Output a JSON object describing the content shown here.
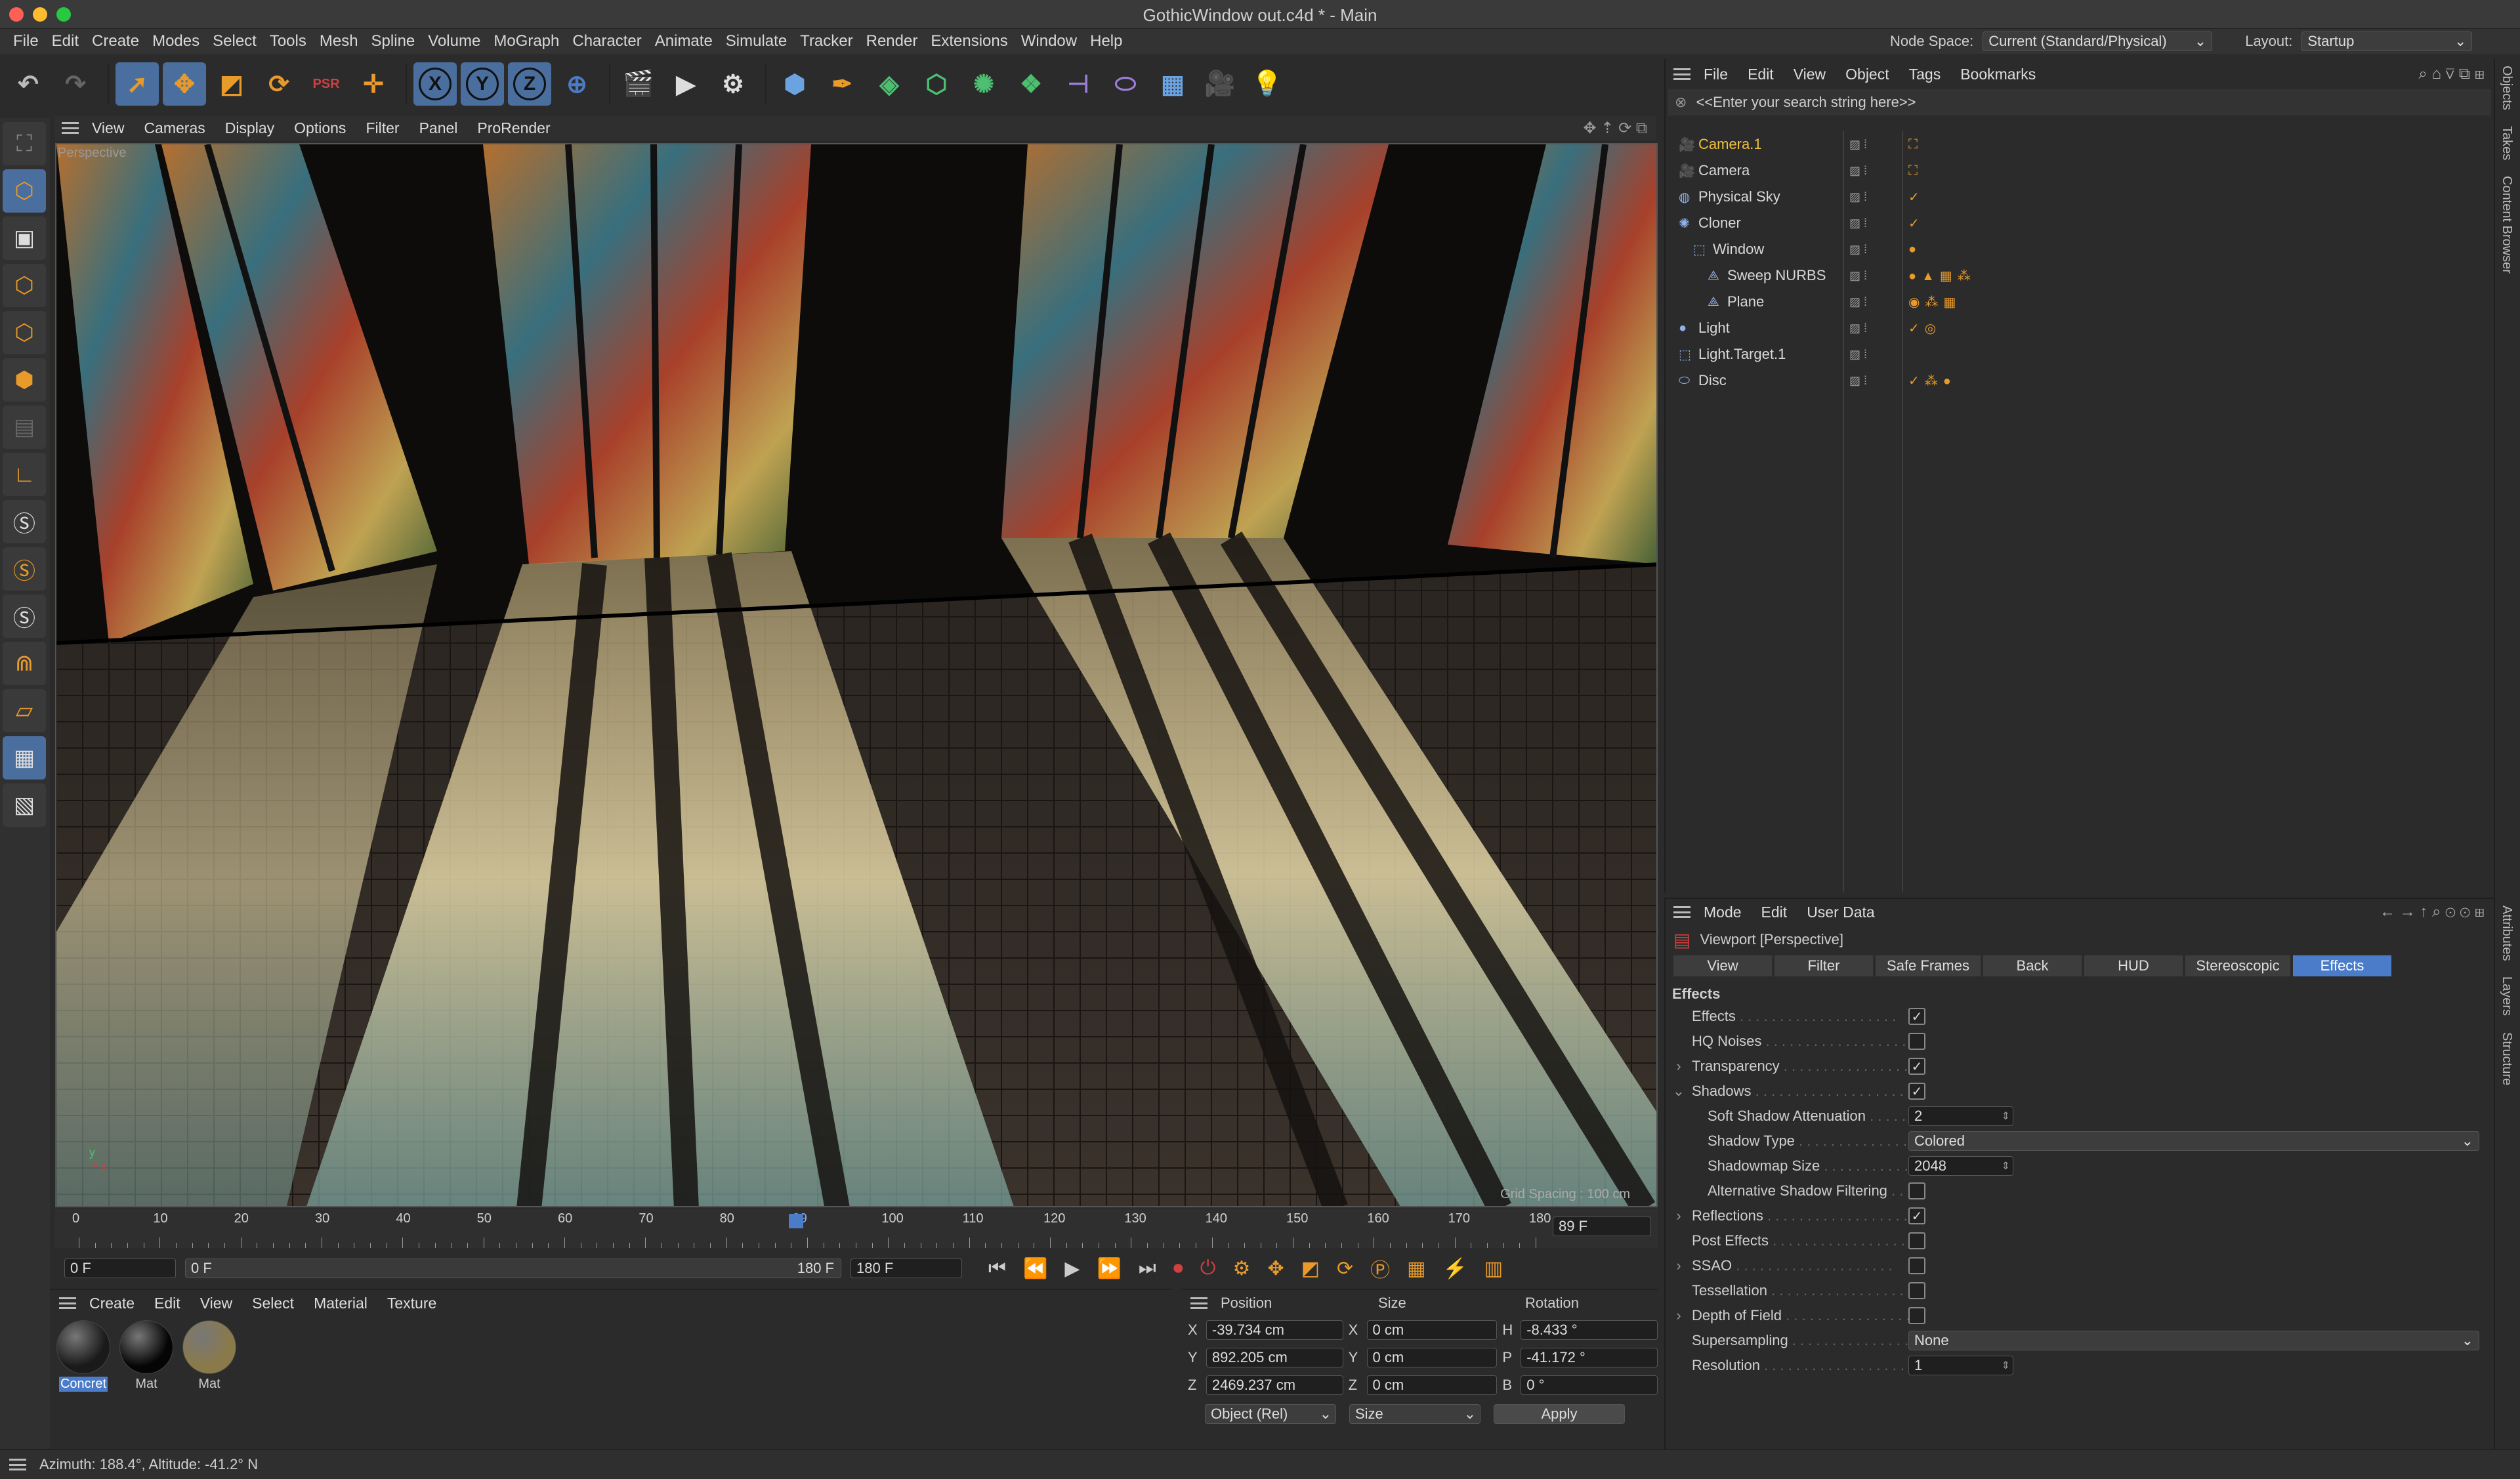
{
  "window": {
    "title": "GothicWindow out.c4d * - Main"
  },
  "menubar": {
    "items": [
      "File",
      "Edit",
      "Create",
      "Modes",
      "Select",
      "Tools",
      "Mesh",
      "Spline",
      "Volume",
      "MoGraph",
      "Character",
      "Animate",
      "Simulate",
      "Tracker",
      "Render",
      "Extensions",
      "Window",
      "Help"
    ],
    "node_space_label": "Node Space:",
    "node_space_value": "Current (Standard/Physical)",
    "layout_label": "Layout:",
    "layout_value": "Startup"
  },
  "toolbar": {
    "axis_x": "X",
    "axis_y": "Y",
    "axis_z": "Z"
  },
  "viewport": {
    "menu": [
      "View",
      "Cameras",
      "Display",
      "Options",
      "Filter",
      "Panel",
      "ProRender"
    ],
    "label": "Perspective",
    "grid_spacing": "Grid Spacing : 100 cm"
  },
  "timeline": {
    "ticks": [
      "0",
      "10",
      "20",
      "30",
      "40",
      "50",
      "60",
      "70",
      "80",
      "89",
      "100",
      "110",
      "120",
      "130",
      "140",
      "150",
      "160",
      "170",
      "180"
    ],
    "current_frame": "89 F",
    "start_field": "0 F",
    "range_start": "0 F",
    "range_end": "180 F",
    "end_field": "180 F"
  },
  "material_manager": {
    "menu": [
      "Create",
      "Edit",
      "View",
      "Select",
      "Material",
      "Texture"
    ],
    "materials": [
      "Concret",
      "Mat",
      "Mat"
    ]
  },
  "coordinates": {
    "headers": {
      "position": "Position",
      "size": "Size",
      "rotation": "Rotation"
    },
    "rows": [
      {
        "axis": "X",
        "pos": "-39.734 cm",
        "size_axis": "X",
        "size": "0 cm",
        "rot_axis": "H",
        "rot": "-8.433 °"
      },
      {
        "axis": "Y",
        "pos": "892.205 cm",
        "size_axis": "Y",
        "size": "0 cm",
        "rot_axis": "P",
        "rot": "-41.172 °"
      },
      {
        "axis": "Z",
        "pos": "2469.237 cm",
        "size_axis": "Z",
        "size": "0 cm",
        "rot_axis": "B",
        "rot": "0 °"
      }
    ],
    "mode": "Object (Rel)",
    "size_mode": "Size",
    "apply": "Apply"
  },
  "status": {
    "text": "Azimuth: 188.4°, Altitude: -41.2°  N"
  },
  "object_manager": {
    "menu": [
      "File",
      "Edit",
      "View",
      "Object",
      "Tags",
      "Bookmarks"
    ],
    "search_placeholder": "<<Enter your search string here>>",
    "objects": [
      {
        "name": "Camera.1",
        "indent": 0,
        "highlight": true
      },
      {
        "name": "Camera",
        "indent": 0,
        "highlight": false
      },
      {
        "name": "Physical Sky",
        "indent": 0,
        "highlight": false
      },
      {
        "name": "Cloner",
        "indent": 0,
        "highlight": false
      },
      {
        "name": "Window",
        "indent": 1,
        "highlight": false
      },
      {
        "name": "Sweep NURBS",
        "indent": 2,
        "highlight": false
      },
      {
        "name": "Plane",
        "indent": 2,
        "highlight": false
      },
      {
        "name": "Light",
        "indent": 0,
        "highlight": false
      },
      {
        "name": "Light.Target.1",
        "indent": 0,
        "highlight": false
      },
      {
        "name": "Disc",
        "indent": 0,
        "highlight": false
      }
    ]
  },
  "side_tabs": {
    "top": [
      "Objects",
      "Takes",
      "Content Browser"
    ],
    "bottom": [
      "Attributes",
      "Layers",
      "Structure"
    ]
  },
  "attributes": {
    "menu": [
      "Mode",
      "Edit",
      "User Data"
    ],
    "object_title": "Viewport [Perspective]",
    "tabs": [
      "View",
      "Filter",
      "Safe Frames",
      "Back",
      "HUD",
      "Stereoscopic",
      "Effects"
    ],
    "active_tab": "Effects",
    "section": "Effects",
    "rows": [
      {
        "label": "Effects",
        "type": "check",
        "checked": true,
        "expander": ""
      },
      {
        "label": "HQ Noises",
        "type": "check",
        "checked": false,
        "expander": ""
      },
      {
        "label": "Transparency",
        "type": "check",
        "checked": true,
        "expander": ">"
      },
      {
        "label": "Shadows",
        "type": "check",
        "checked": true,
        "expander": "v"
      },
      {
        "label": "Soft Shadow Attenuation",
        "type": "number",
        "value": "2",
        "expander": "",
        "sub": true
      },
      {
        "label": "Shadow Type",
        "type": "dropdown",
        "value": "Colored",
        "expander": "",
        "sub": true
      },
      {
        "label": "Shadowmap Size",
        "type": "number",
        "value": "2048",
        "expander": "",
        "sub": true
      },
      {
        "label": "Alternative Shadow Filtering",
        "type": "check",
        "checked": false,
        "expander": "",
        "sub": true
      },
      {
        "label": "Reflections",
        "type": "check",
        "checked": true,
        "expander": ">"
      },
      {
        "label": "Post Effects",
        "type": "check",
        "checked": false,
        "expander": ""
      },
      {
        "label": "SSAO",
        "type": "check",
        "checked": false,
        "expander": ">"
      },
      {
        "label": "Tessellation",
        "type": "check",
        "checked": false,
        "expander": ""
      },
      {
        "label": "Depth of Field",
        "type": "check",
        "checked": false,
        "expander": ">"
      },
      {
        "label": "Supersampling",
        "type": "dropdown",
        "value": "None",
        "expander": ""
      },
      {
        "label": "Resolution",
        "type": "number",
        "value": "1",
        "expander": ""
      }
    ]
  },
  "colors": {
    "accent": "#4a7cc9",
    "highlight_object": "#f0c040",
    "orange": "#e89a2b"
  }
}
